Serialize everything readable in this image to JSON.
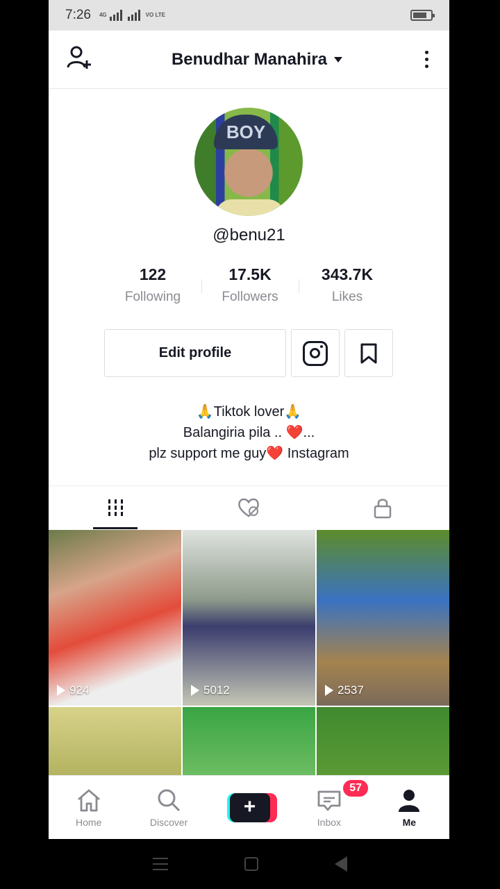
{
  "status_bar": {
    "time": "7:26",
    "network_label": "4G",
    "volte_label": "VO LTE"
  },
  "header": {
    "title": "Benudhar Manahira"
  },
  "profile": {
    "avatar_cap_text": "BOY",
    "username": "@benu21",
    "stats": [
      {
        "value": "122",
        "label": "Following"
      },
      {
        "value": "17.5K",
        "label": "Followers"
      },
      {
        "value": "343.7K",
        "label": "Likes"
      }
    ],
    "edit_label": "Edit profile",
    "bio": [
      "🙏Tiktok lover🙏",
      "Balangiria pila .. ❤️...",
      "plz support me guy❤️ Instagram"
    ]
  },
  "videos": [
    {
      "views": "924"
    },
    {
      "views": "5012"
    },
    {
      "views": "2537"
    },
    {
      "views": ""
    },
    {
      "views": ""
    },
    {
      "views": ""
    }
  ],
  "bottom_nav": {
    "items": [
      "Home",
      "Discover",
      "",
      "Inbox",
      "Me"
    ],
    "inbox_badge": "57"
  },
  "colors": {
    "accent_red": "#fe2c55",
    "accent_cyan": "#25f4ee",
    "text": "#161823",
    "muted": "#8a8b91"
  }
}
